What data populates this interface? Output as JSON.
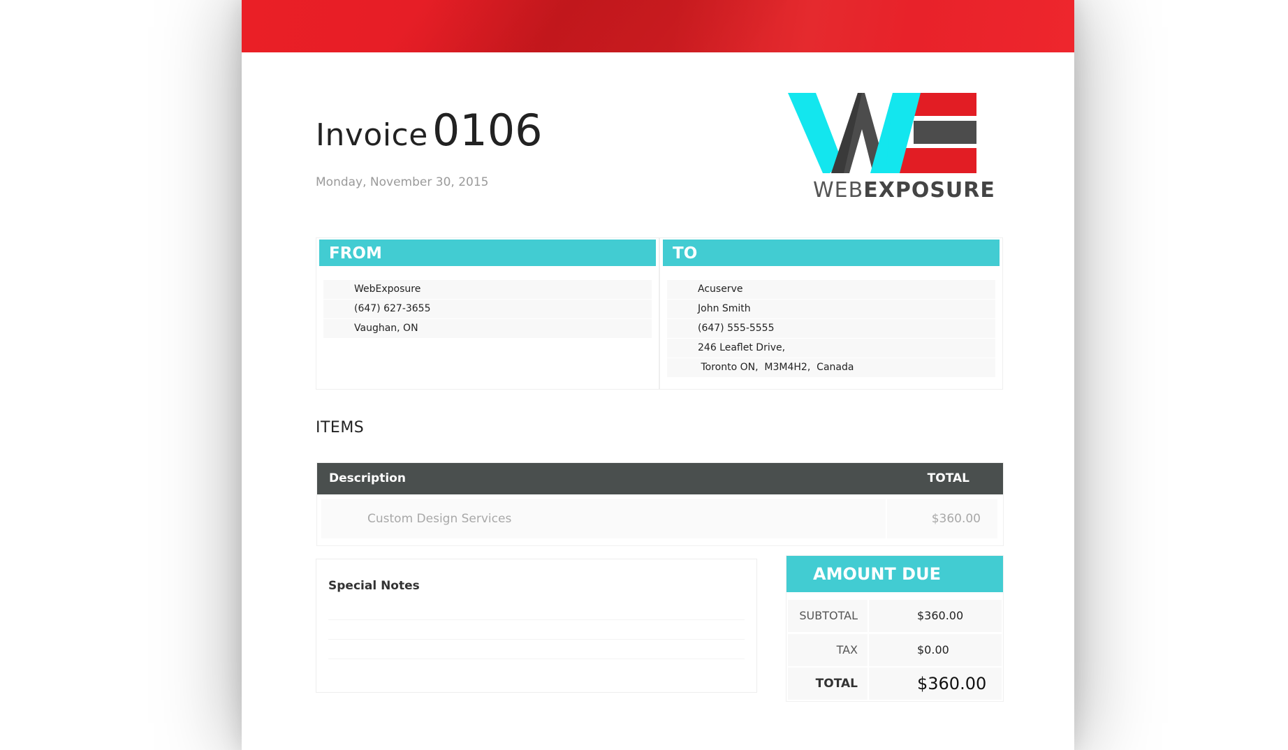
{
  "invoice": {
    "title_word": "Invoice",
    "number": "0106",
    "date": "Monday, November 30, 2015"
  },
  "logo": {
    "brand_web": "WEB",
    "brand_exposure": "EXPOSURE",
    "colors": {
      "cyan": "#13e6ee",
      "gray": "#4c4c4c",
      "red": "#e21d24"
    }
  },
  "from": {
    "heading": "FROM",
    "lines": [
      "WebExposure",
      "(647) 627-3655",
      "Vaughan, ON"
    ]
  },
  "to": {
    "heading": "TO",
    "lines": [
      "Acuserve",
      "John Smith",
      "(647) 555-5555",
      "246 Leaflet Drive,",
      " Toronto ON,  M3M4H2,  Canada"
    ]
  },
  "items": {
    "heading": "ITEMS",
    "columns": {
      "description": "Description",
      "total": "TOTAL"
    },
    "rows": [
      {
        "description": "Custom Design Services",
        "total": "$360.00"
      }
    ]
  },
  "notes": {
    "label": "Special Notes"
  },
  "amount_due": {
    "heading": "AMOUNT DUE",
    "subtotal_label": "SUBTOTAL",
    "subtotal": "$360.00",
    "tax_label": "TAX",
    "tax": "$0.00",
    "total_label": "TOTAL",
    "total": "$360.00"
  },
  "colors": {
    "banner_red": "#e61e26",
    "accent_teal": "#42ccd2",
    "table_header": "#4a4f4e"
  }
}
